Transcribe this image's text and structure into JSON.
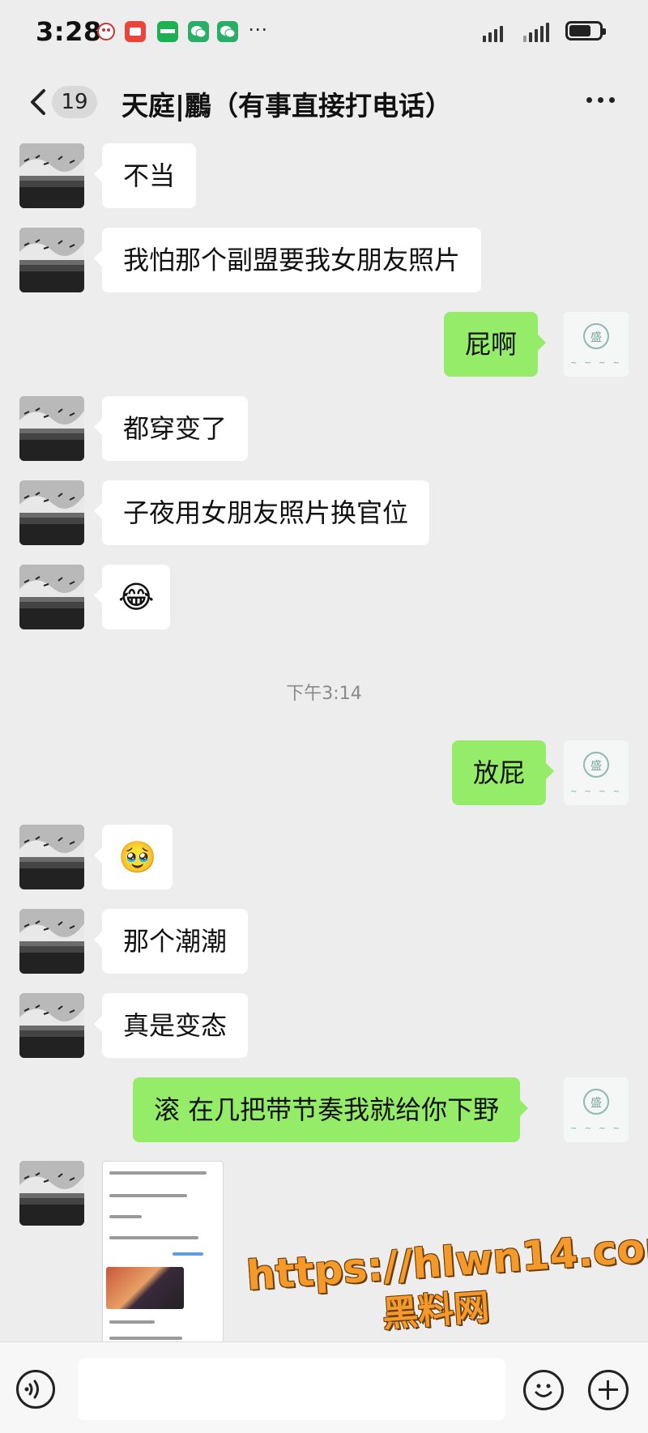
{
  "status_bar": {
    "time": "3:28",
    "icons": [
      "game-icon",
      "red-app-icon",
      "green-app-icon",
      "wechat-icon",
      "wechat-icon"
    ],
    "overflow": "⋯"
  },
  "header": {
    "unread_count": "19",
    "title": "天庭|鸝（有事直接打电话）"
  },
  "messages": [
    {
      "side": "in",
      "text": "不当"
    },
    {
      "side": "in",
      "text": "我怕那个副盟要我女朋友照片"
    },
    {
      "side": "out",
      "text": "屁啊"
    },
    {
      "side": "in",
      "text": "都穿变了"
    },
    {
      "side": "in",
      "text": "子夜用女朋友照片换官位"
    },
    {
      "side": "in",
      "emoji": "😂"
    },
    {
      "side": "out",
      "text": "放屁"
    },
    {
      "side": "in",
      "emoji": "🥹"
    },
    {
      "side": "in",
      "text": "那个潮潮"
    },
    {
      "side": "in",
      "text": "真是变态"
    },
    {
      "side": "out",
      "text": "滚 在几把带节奏我就给你下野"
    }
  ],
  "timestamp": "下午3:14",
  "self_avatar_text": "盛",
  "watermark": {
    "url": "https://hlwn14.com",
    "site": "黑料网"
  },
  "colors": {
    "background": "#ededed",
    "bubble_in": "#ffffff",
    "bubble_out": "#95ec69",
    "watermark": "#f39a2a"
  }
}
